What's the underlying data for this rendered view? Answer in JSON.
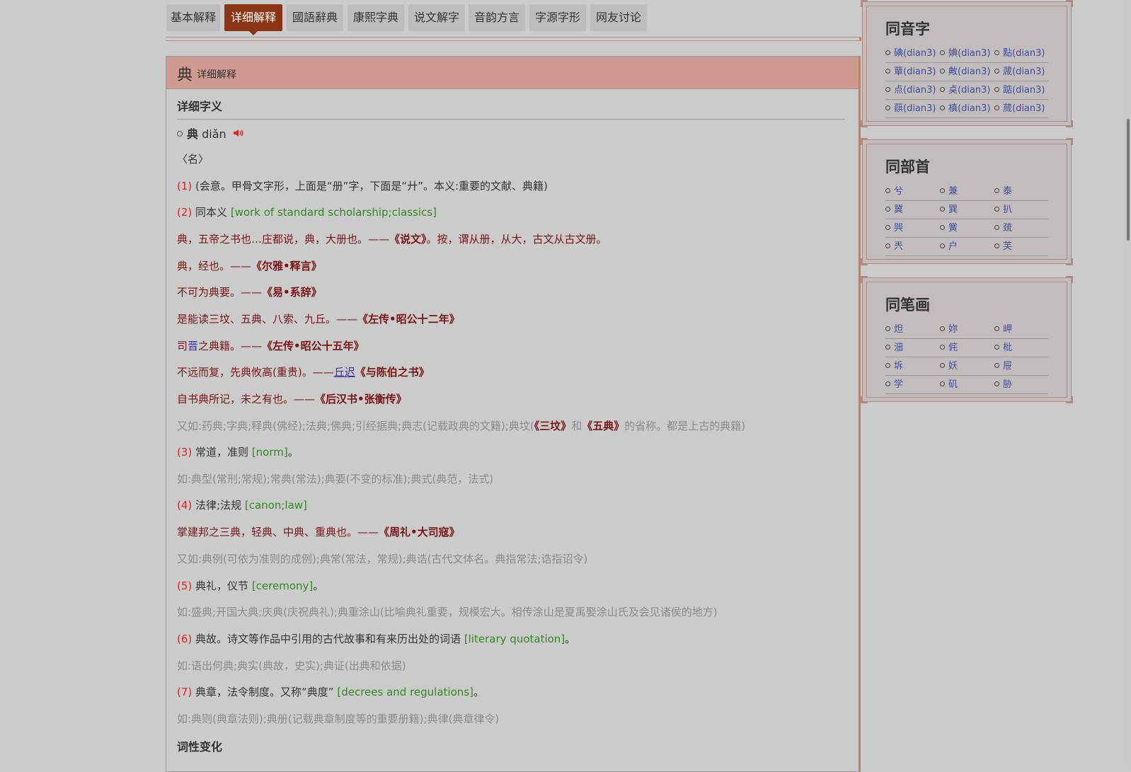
{
  "tabs": [
    {
      "label": "基本解释"
    },
    {
      "label": "详细解释"
    },
    {
      "label": "國語辭典"
    },
    {
      "label": "康熙字典"
    },
    {
      "label": "说文解字"
    },
    {
      "label": "音韵方言"
    },
    {
      "label": "字源字形"
    },
    {
      "label": "网友讨论"
    }
  ],
  "panel": {
    "char": "典",
    "subtitle": "详细解释",
    "section1": "详细字义",
    "headword": "典",
    "pinyin": "diǎn",
    "pos": "〈名〉",
    "sense1": {
      "num": "(1)",
      "def": "(会意。甲骨文字形，上面是“册”字，下面是“廾”。本义:重要的文献、典籍)"
    },
    "sense2": {
      "num": "(2)",
      "def": "同本义",
      "en": "[work of standard scholarship;classics]"
    },
    "q1": {
      "text": "典，五帝之书也…庄都说，典，大册也。——",
      "src": "《说文》",
      "tail": "。按，谓从册，从大，古文从古文册。"
    },
    "q2": {
      "text": "典，经也。——",
      "src": "《尔雅•释言》"
    },
    "q3": {
      "text": "不可为典要。——",
      "src": "《易•系辞》"
    },
    "q4": {
      "text": "是能读三坟、五典、八索、九丘。——",
      "src": "《左传•昭公十二年》"
    },
    "q5": {
      "pre": "司",
      "link": "晋",
      "text": "之典籍。——",
      "src": "《左传•昭公十五年》"
    },
    "q6": {
      "text": "不远而复，先典攸高(重贵)。——",
      "link": "丘迟",
      "src": "《与陈伯之书》"
    },
    "q7": {
      "text": "自书典所记，未之有也。——",
      "src": "《后汉书•张衡传》"
    },
    "ex2": {
      "text": "又如:药典;字典;释典(佛经);法典;佛典;引经据典;典志(记载政典的文籍);典坟(",
      "b1": "《三坟》",
      "mid": "和",
      "b2": "《五典》",
      "tail": "的省称。都是上古的典籍)"
    },
    "sense3": {
      "num": "(3)",
      "def": "常道，准则",
      "en": "[norm]",
      "end": "。"
    },
    "ex3": "如:典型(常刑;常规);常典(常法);典要(不变的标准);典式(典范，法式)",
    "sense4": {
      "num": "(4)",
      "def": "法律;法规",
      "en": "[canon;law]"
    },
    "q8": {
      "text": "掌建邦之三典，轻典、中典、重典也。——",
      "src": "《周礼•大司寇》"
    },
    "ex4": "又如:典例(可依为准则的成例);典常(常法，常规);典诰(古代文体名。典指常法;诰指诏令)",
    "sense5": {
      "num": "(5)",
      "def": "典礼，仪节",
      "en": "[ceremony]",
      "end": "。"
    },
    "ex5": "如:盛典;开国大典;庆典(庆祝典礼);典重涂山(比喻典礼重要，规模宏大。相传涂山是夏禹娶涂山氏及会见诸侯的地方)",
    "sense6": {
      "num": "(6)",
      "def": "典故。诗文等作品中引用的古代故事和有来历出处的词语",
      "en": "[literary quotation]",
      "end": "。"
    },
    "ex6": "如:语出何典;典实(典故，史实);典证(出典和依据)",
    "sense7": {
      "num": "(7)",
      "def": "典章，法令制度。又称“典度”",
      "en": "[decrees and regulations]",
      "end": "。"
    },
    "ex7": "如:典则(典章法则);典册(记载典章制度等的重要册籍);典律(典章律令)",
    "section2": "词性变化"
  },
  "sidebar": {
    "homophones": {
      "title": "同音字",
      "items": [
        "碘(dian3)",
        "婰(dian3)",
        "點(dian3)",
        "蕇(dian3)",
        "敟(dian3)",
        "蒧(dian3)",
        "点(dian3)",
        "奌(dian3)",
        "踮(dian3)",
        "蕻(dian3)",
        "槙(dian3)",
        "蒇(dian3)"
      ]
    },
    "radical": {
      "title": "同部首",
      "items": [
        "兮",
        "兼",
        "泰",
        "冀",
        "巽",
        "扒",
        "巺",
        "黉",
        "巯",
        "兲",
        "户",
        "芙"
      ]
    },
    "strokes": {
      "title": "同笔画",
      "items": [
        "炟",
        "妳",
        "岬",
        "沺",
        "侂",
        "枇",
        "坼",
        "妖",
        "屉",
        "学",
        "矶",
        "胁"
      ]
    }
  },
  "colors": {
    "accent": "#8c3514",
    "header": "#cf9a90",
    "number": "#dd2222",
    "english": "#2e8a1f",
    "quote": "#7a1414",
    "example": "#8b8b8b"
  }
}
